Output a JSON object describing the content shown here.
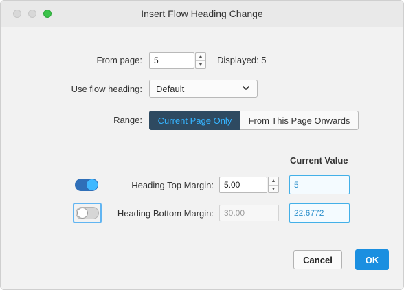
{
  "window": {
    "title": "Insert Flow Heading Change"
  },
  "from_page": {
    "label": "From page:",
    "value": "5",
    "displayed": "Displayed: 5"
  },
  "flow_heading": {
    "label": "Use flow heading:",
    "selected": "Default",
    "icon": "chevron-down-icon"
  },
  "range": {
    "label": "Range:",
    "options": [
      "Current Page Only",
      "From This Page Onwards"
    ],
    "selected": "Current Page Only"
  },
  "current_value_header": "Current Value",
  "top_margin": {
    "enabled": true,
    "label": "Heading Top Margin:",
    "value": "5.00",
    "current": "5"
  },
  "bottom_margin": {
    "enabled": false,
    "label": "Heading Bottom Margin:",
    "value": "30.00",
    "current": "22.6772"
  },
  "buttons": {
    "cancel": "Cancel",
    "ok": "OK"
  },
  "colors": {
    "accent": "#1b8fe0",
    "segment_active_bg": "#2e4a61",
    "segment_active_text": "#36b4ff",
    "toggle_on": "#2f6fb8"
  }
}
